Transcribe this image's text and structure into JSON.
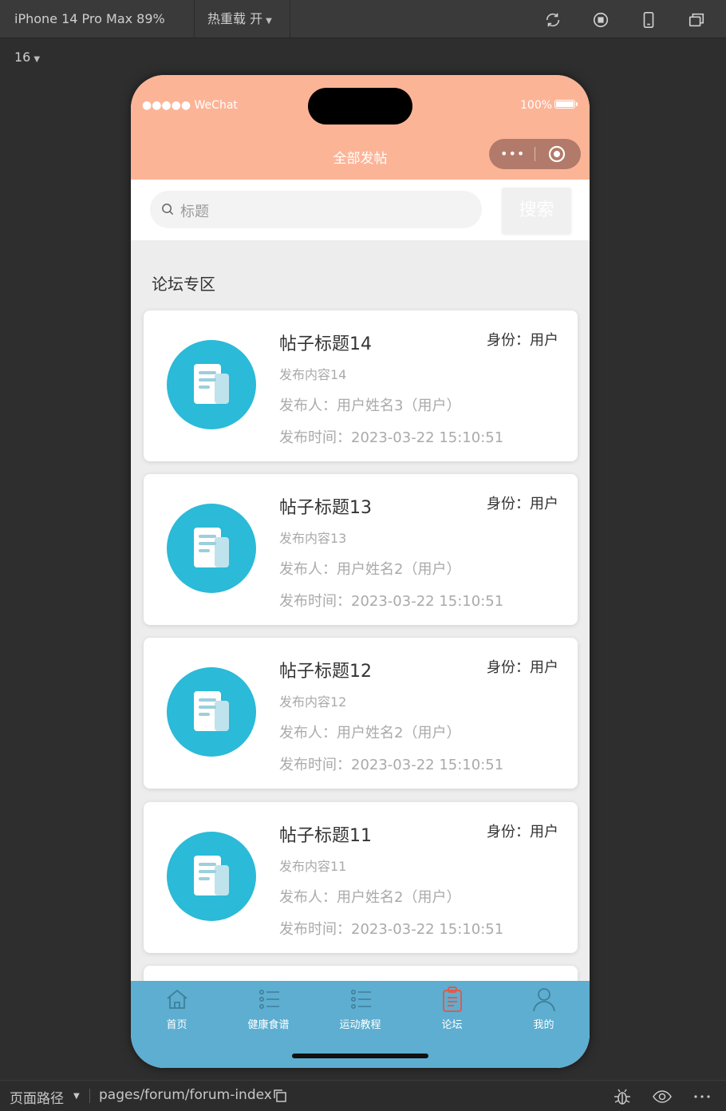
{
  "devtools": {
    "device_label": "iPhone 14 Pro Max 89% 16",
    "hot_reload_label": "热重载 开",
    "path_label": "页面路径",
    "path_value": "pages/forum/forum-index"
  },
  "status_bar": {
    "signal": "●●●●● WeChat",
    "battery": "100%"
  },
  "nav": {
    "title": "全部发帖",
    "capsule_dots": "•••"
  },
  "search": {
    "placeholder": "标题",
    "button_label": "搜索"
  },
  "section_title": "论坛专区",
  "posts": [
    {
      "title": "帖子标题14",
      "role": "身份：用户",
      "content": "发布内容14",
      "author": "发布人：用户姓名3（用户）",
      "time": "发布时间：2023-03-22 15:10:51"
    },
    {
      "title": "帖子标题13",
      "role": "身份：用户",
      "content": "发布内容13",
      "author": "发布人：用户姓名2（用户）",
      "time": "发布时间：2023-03-22 15:10:51"
    },
    {
      "title": "帖子标题12",
      "role": "身份：用户",
      "content": "发布内容12",
      "author": "发布人：用户姓名2（用户）",
      "time": "发布时间：2023-03-22 15:10:51"
    },
    {
      "title": "帖子标题11",
      "role": "身份：用户",
      "content": "发布内容11",
      "author": "发布人：用户姓名2（用户）",
      "time": "发布时间：2023-03-22 15:10:51"
    }
  ],
  "tabs": [
    {
      "label": "首页",
      "icon": "home-icon",
      "active": false
    },
    {
      "label": "健康食谱",
      "icon": "list-icon",
      "active": false
    },
    {
      "label": "运动教程",
      "icon": "list-icon",
      "active": false
    },
    {
      "label": "论坛",
      "icon": "clipboard-icon",
      "active": true
    },
    {
      "label": "我的",
      "icon": "user-icon",
      "active": false
    }
  ],
  "colors": {
    "header": "#fcb497",
    "tabbar": "#5daed0",
    "active_tab_icon": "#e05a4e",
    "avatar": "#2bbad8"
  }
}
